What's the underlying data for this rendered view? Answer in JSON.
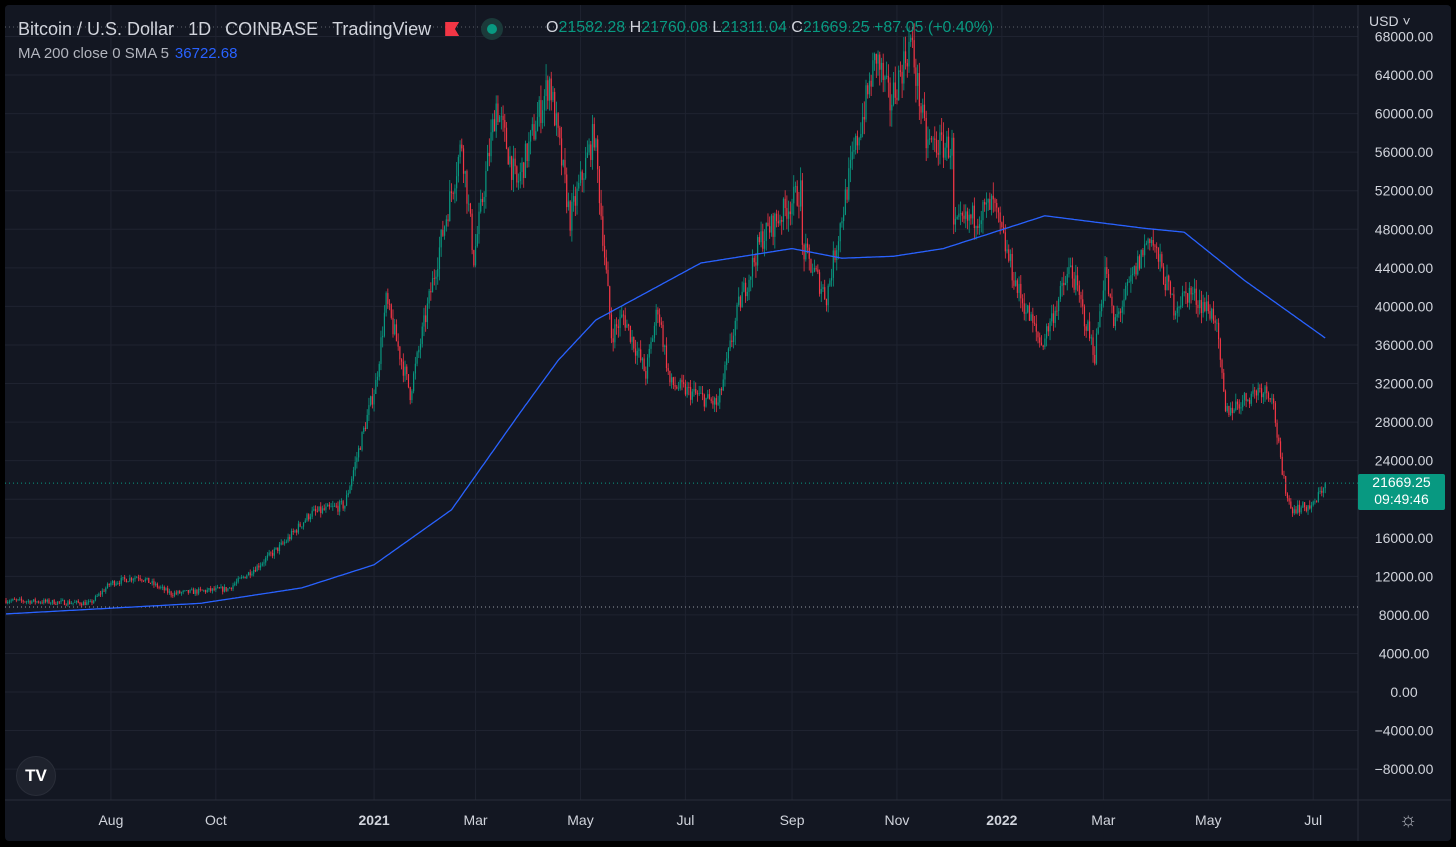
{
  "header": {
    "symbol": "Bitcoin / U.S. Dollar",
    "interval": "1D",
    "exchange": "COINBASE",
    "source": "TradingView",
    "ohlc": {
      "o_label": "O",
      "o": "21582.28",
      "h_label": "H",
      "h": "21760.08",
      "l_label": "L",
      "l": "21311.04",
      "c_label": "C",
      "c": "21669.25",
      "change": "+87.05 (+0.40%)"
    }
  },
  "indicator": {
    "label": "MA 200 close 0 SMA 5",
    "value": "36722.68"
  },
  "currency": "USD ˅",
  "last_price": {
    "price": "21669.25",
    "countdown": "09:49:46"
  },
  "logo": "TV",
  "settings_icon": "☼",
  "colors": {
    "bg": "#131722",
    "up": "#089981",
    "down": "#f23645",
    "ma": "#2962ff",
    "grid": "#1f2330",
    "text": "#d1d4dc"
  },
  "chart_data": {
    "type": "candlestick",
    "title": "Bitcoin / U.S. Dollar 1D COINBASE",
    "start_date": "2020-06-01",
    "ylim": [
      -10000,
      70000
    ],
    "y_ticks": [
      "68000.00",
      "64000.00",
      "60000.00",
      "56000.00",
      "52000.00",
      "48000.00",
      "44000.00",
      "40000.00",
      "36000.00",
      "32000.00",
      "28000.00",
      "24000.00",
      "20000.00",
      "16000.00",
      "12000.00",
      "8000.00",
      "4000.00",
      "0.00",
      "−4000.00",
      "−8000.00"
    ],
    "y_tick_values": [
      68000,
      64000,
      60000,
      56000,
      52000,
      48000,
      44000,
      40000,
      36000,
      32000,
      28000,
      24000,
      20000,
      16000,
      12000,
      8000,
      4000,
      0,
      -4000,
      -8000
    ],
    "x_ticks": [
      {
        "label": "Aug",
        "date": "2020-08-01"
      },
      {
        "label": "Oct",
        "date": "2020-10-01"
      },
      {
        "label": "2021",
        "date": "2021-01-01",
        "bold": true
      },
      {
        "label": "Mar",
        "date": "2021-03-01"
      },
      {
        "label": "May",
        "date": "2021-05-01"
      },
      {
        "label": "Jul",
        "date": "2021-07-01"
      },
      {
        "label": "Sep",
        "date": "2021-09-01"
      },
      {
        "label": "Nov",
        "date": "2021-11-01"
      },
      {
        "label": "2022",
        "date": "2022-01-01",
        "bold": true
      },
      {
        "label": "Mar",
        "date": "2022-03-01"
      },
      {
        "label": "May",
        "date": "2022-05-01"
      },
      {
        "label": "Jul",
        "date": "2022-07-01"
      }
    ],
    "price_path": [
      [
        "2020-06-01",
        9500
      ],
      [
        "2020-07-20",
        9200
      ],
      [
        "2020-08-01",
        11300
      ],
      [
        "2020-08-17",
        12000
      ],
      [
        "2020-09-05",
        10200
      ],
      [
        "2020-10-08",
        10700
      ],
      [
        "2020-10-25",
        13000
      ],
      [
        "2020-11-10",
        15500
      ],
      [
        "2020-11-25",
        18500
      ],
      [
        "2020-12-15",
        19400
      ],
      [
        "2020-12-20",
        23000
      ],
      [
        "2021-01-02",
        32000
      ],
      [
        "2021-01-08",
        40500
      ],
      [
        "2021-01-22",
        31000
      ],
      [
        "2021-02-08",
        46000
      ],
      [
        "2021-02-21",
        57000
      ],
      [
        "2021-02-28",
        45000
      ],
      [
        "2021-03-13",
        61000
      ],
      [
        "2021-03-25",
        52500
      ],
      [
        "2021-04-13",
        63500
      ],
      [
        "2021-04-25",
        49000
      ],
      [
        "2021-05-09",
        58000
      ],
      [
        "2021-05-19",
        37000
      ],
      [
        "2021-05-26",
        39000
      ],
      [
        "2021-06-08",
        33000
      ],
      [
        "2021-06-15",
        40000
      ],
      [
        "2021-06-22",
        32000
      ],
      [
        "2021-07-20",
        29800
      ],
      [
        "2021-08-01",
        40000
      ],
      [
        "2021-08-14",
        47000
      ],
      [
        "2021-09-06",
        52000
      ],
      [
        "2021-09-07",
        46000
      ],
      [
        "2021-09-21",
        41000
      ],
      [
        "2021-10-06",
        55000
      ],
      [
        "2021-10-20",
        66000
      ],
      [
        "2021-10-28",
        61000
      ],
      [
        "2021-11-09",
        67500
      ],
      [
        "2021-11-18",
        57000
      ],
      [
        "2021-12-03",
        56500
      ],
      [
        "2021-12-04",
        48000
      ],
      [
        "2021-12-27",
        50500
      ],
      [
        "2022-01-10",
        41800
      ],
      [
        "2022-01-24",
        36000
      ],
      [
        "2022-02-10",
        44000
      ],
      [
        "2022-02-24",
        35000
      ],
      [
        "2022-03-02",
        44000
      ],
      [
        "2022-03-07",
        38000
      ],
      [
        "2022-03-28",
        47500
      ],
      [
        "2022-04-11",
        40000
      ],
      [
        "2022-04-20",
        41500
      ],
      [
        "2022-05-05",
        39000
      ],
      [
        "2022-05-11",
        29000
      ],
      [
        "2022-05-31",
        31500
      ],
      [
        "2022-06-07",
        31000
      ],
      [
        "2022-06-13",
        22500
      ],
      [
        "2022-06-18",
        19000
      ],
      [
        "2022-07-01",
        19300
      ],
      [
        "2022-07-08",
        21669.25
      ]
    ],
    "ma200": [
      [
        "2020-06-01",
        8100
      ],
      [
        "2020-09-22",
        9200
      ],
      [
        "2020-11-20",
        10800
      ],
      [
        "2021-01-01",
        13200
      ],
      [
        "2021-02-15",
        18900
      ],
      [
        "2021-03-27",
        29000
      ],
      [
        "2021-04-18",
        34400
      ],
      [
        "2021-05-10",
        38600
      ],
      [
        "2021-07-10",
        44500
      ],
      [
        "2021-09-01",
        46000
      ],
      [
        "2021-09-30",
        45000
      ],
      [
        "2021-10-30",
        45200
      ],
      [
        "2021-11-28",
        46000
      ],
      [
        "2022-01-26",
        49400
      ],
      [
        "2022-03-25",
        48100
      ],
      [
        "2022-04-17",
        47700
      ],
      [
        "2022-05-22",
        42700
      ],
      [
        "2022-07-08",
        36722.68
      ]
    ],
    "last_price": 21669.25
  }
}
